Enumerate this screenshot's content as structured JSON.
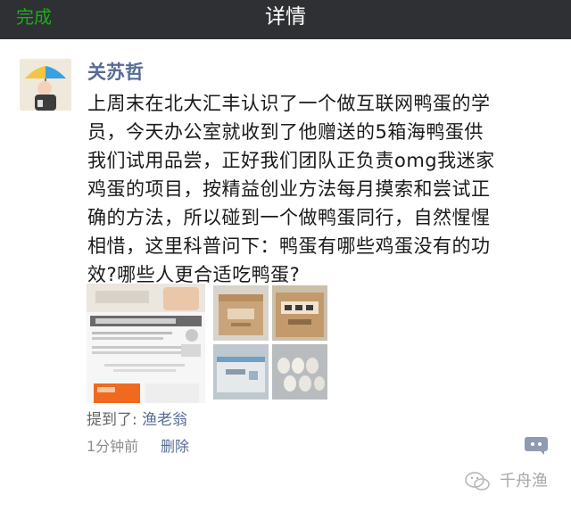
{
  "header": {
    "done_label": "完成",
    "title": "详情"
  },
  "post": {
    "author": "关苏哲",
    "text_lines": [
      "上周末在北大汇丰认识了一个做互联网鸭蛋的学",
      "员，今天办公室就收到了他赠送的5箱海鸭蛋供",
      "我们试用品尝，正好我们团队正负责omg我迷家",
      "鸡蛋的项目，按精益创业方法每月摸索和尝试正",
      "确的方法，所以碰到一个做鸭蛋同行，自然惺惺",
      "相惜，这里科普问下：鸭蛋有哪些鸡蛋没有的功",
      "效?哪些人更合适吃鸭蛋?"
    ],
    "mention_prefix": "提到了:",
    "mention_name": "渔老翁",
    "time": "1分钟前",
    "delete_label": "删除"
  },
  "colors": {
    "accent_green": "#1aad19",
    "link_blue": "#576b95",
    "topbar_bg": "#2f3033"
  },
  "icons": {
    "comment": "comment-bubble-icon",
    "watermark": "wechat-logo"
  },
  "watermark_text": "千舟渔"
}
